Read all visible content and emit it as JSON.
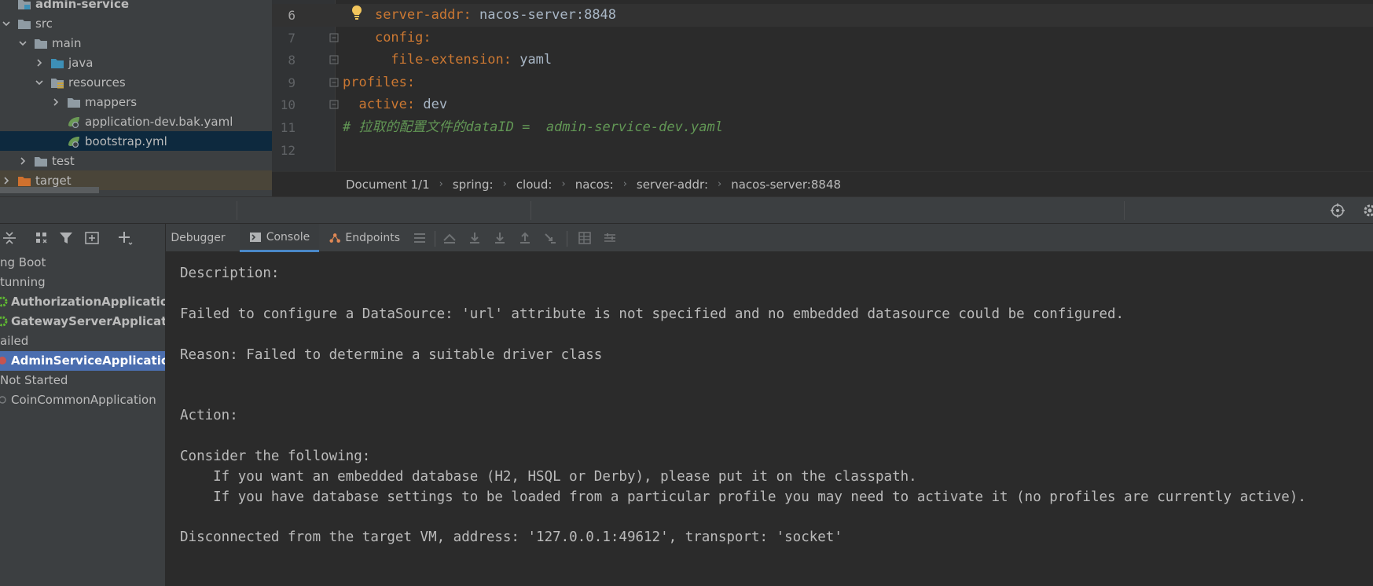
{
  "project_tree": {
    "items": [
      {
        "label": "admin-service",
        "depth": 0,
        "icon": "module-folder-icon"
      },
      {
        "label": "src",
        "depth": 0,
        "icon": "folder-icon",
        "expanded": true
      },
      {
        "label": "main",
        "depth": 1,
        "icon": "folder-icon",
        "expanded": true
      },
      {
        "label": "java",
        "depth": 2,
        "icon": "source-folder-icon",
        "expanded": false
      },
      {
        "label": "resources",
        "depth": 2,
        "icon": "resources-folder-icon",
        "expanded": true
      },
      {
        "label": "mappers",
        "depth": 3,
        "icon": "folder-icon",
        "expanded": false
      },
      {
        "label": "application-dev.bak.yaml",
        "depth": 3,
        "icon": "spring-yaml-icon"
      },
      {
        "label": "bootstrap.yml",
        "depth": 3,
        "icon": "spring-yaml-icon",
        "selected": true
      },
      {
        "label": "test",
        "depth": 1,
        "icon": "folder-icon",
        "expanded": false
      },
      {
        "label": "target",
        "depth": 0,
        "icon": "excluded-folder-icon",
        "expanded": false
      }
    ]
  },
  "editor": {
    "lines": [
      {
        "no": "6",
        "indent": "    ",
        "key": "server-addr",
        "value": " nacos-server:8848",
        "current": true
      },
      {
        "no": "7",
        "indent": "    ",
        "key": "config",
        "value": ""
      },
      {
        "no": "8",
        "indent": "      ",
        "key": "file-extension",
        "value": " yaml"
      },
      {
        "no": "9",
        "indent": "",
        "key": "profiles",
        "value": ""
      },
      {
        "no": "10",
        "indent": "  ",
        "key": "active",
        "value": " dev"
      },
      {
        "no": "11",
        "comment": "# 拉取的配置文件的dataID =  admin-service-dev.yaml"
      },
      {
        "no": "12"
      }
    ]
  },
  "breadcrumb": [
    "Document 1/1",
    "spring:",
    "cloud:",
    "nacos:",
    "server-addr:",
    "nacos-server:8848"
  ],
  "services": {
    "items": [
      {
        "label": "ng Boot",
        "kind": "group"
      },
      {
        "label": "tunning",
        "kind": "group"
      },
      {
        "label": "AuthorizationApplication",
        "kind": "running-app",
        "suffix": ":"
      },
      {
        "label": "GatewayServerApplication",
        "kind": "running-app"
      },
      {
        "label": "ailed",
        "kind": "group"
      },
      {
        "label": "AdminServiceApplication",
        "kind": "failed-app",
        "selected": true
      },
      {
        "label": "Not Started",
        "kind": "group"
      },
      {
        "label": "CoinCommonApplication",
        "kind": "idle-app"
      }
    ]
  },
  "console_tabs": {
    "debugger": "Debugger",
    "console": "Console",
    "endpoints": "Endpoints"
  },
  "console": {
    "lines": [
      {
        "row": 1,
        "text": "Description:"
      },
      {
        "row": 3,
        "text": "Failed to configure a DataSource: 'url' attribute is not specified and no embedded datasource could be configured."
      },
      {
        "row": 5,
        "text": "Reason: Failed to determine a suitable driver class"
      },
      {
        "row": 8,
        "text": "Action:"
      },
      {
        "row": 10,
        "text": "Consider the following:"
      },
      {
        "row": 11,
        "text": "    If you want an embedded database (H2, HSQL or Derby), please put it on the classpath."
      },
      {
        "row": 12,
        "text": "    If you have database settings to be loaded from a particular profile you may need to activate it (no profiles are currently active)."
      },
      {
        "row": 14,
        "text": "Disconnected from the target VM, address: '127.0.0.1:49612', transport: 'socket'"
      }
    ]
  },
  "colors": {
    "yaml_key": "#cc7832",
    "comment": "#629755",
    "selection": "#4b6eaf",
    "running": "#5fb832",
    "failed": "#c75450"
  }
}
